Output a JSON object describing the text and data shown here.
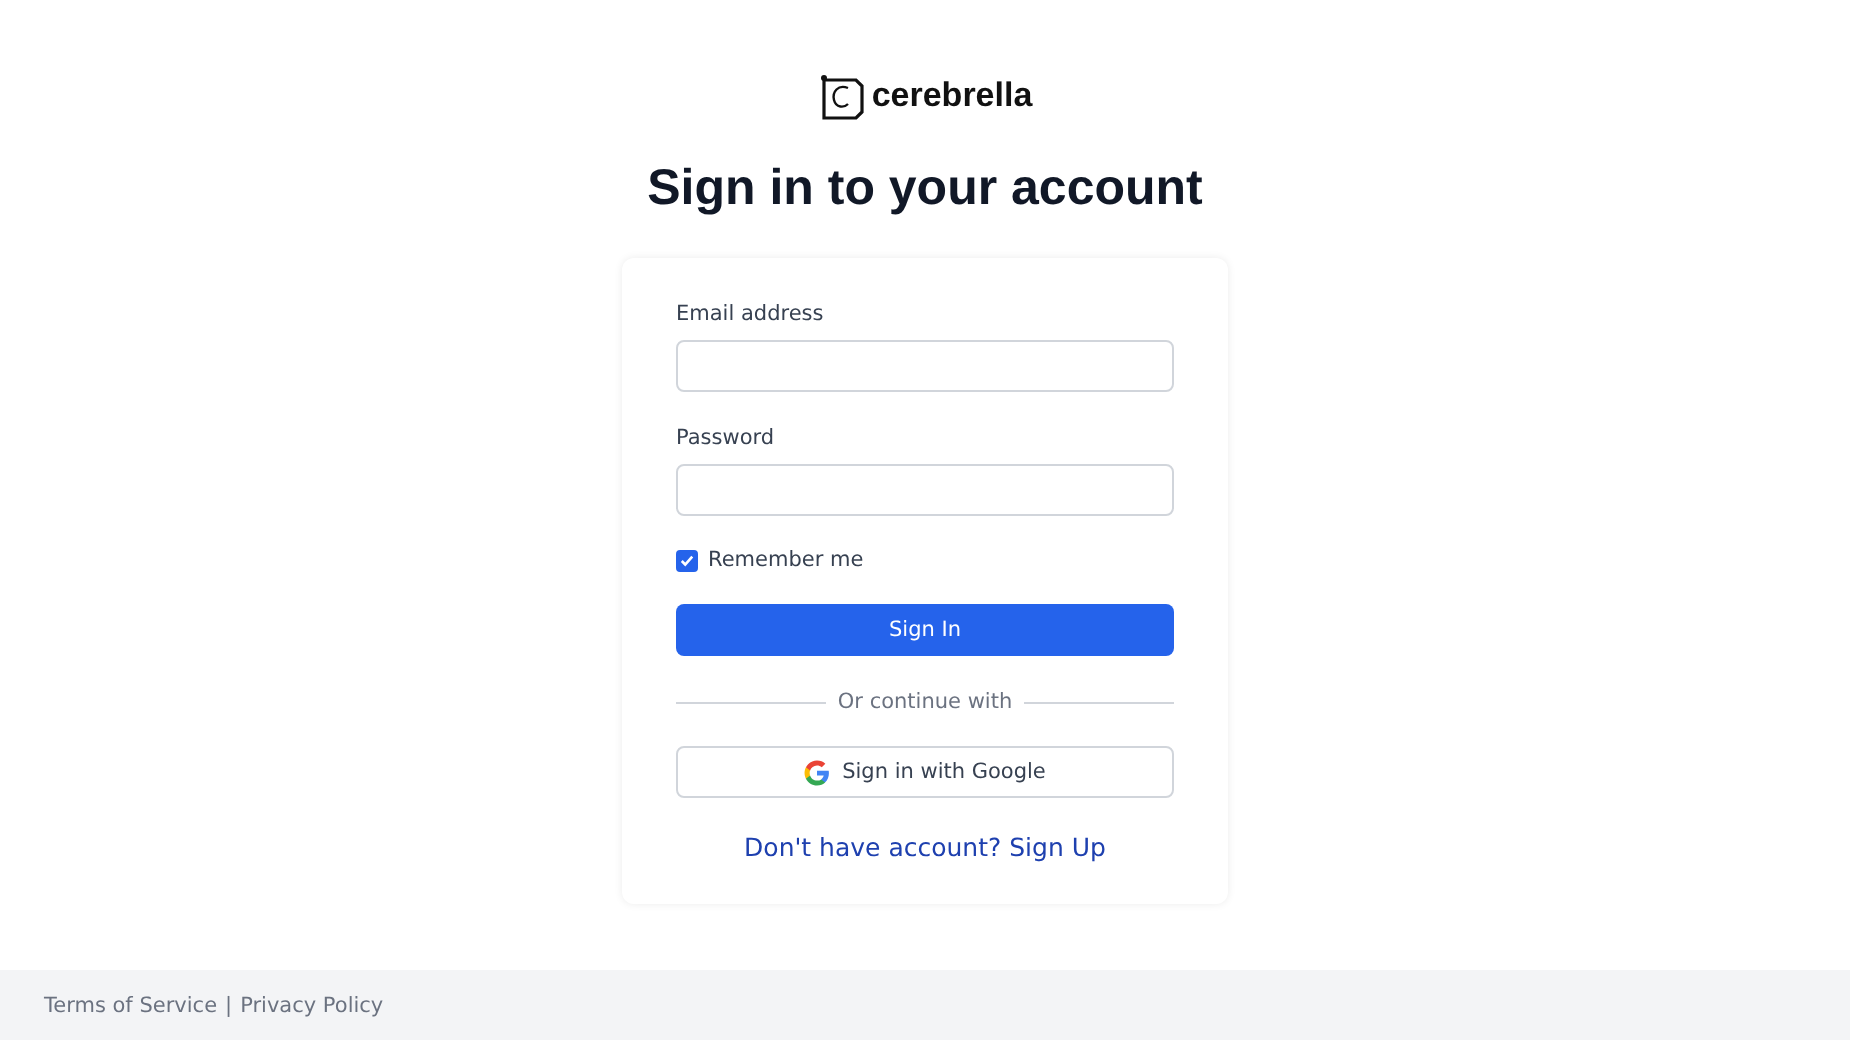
{
  "logo": {
    "text": "cerebrella"
  },
  "title": "Sign in to your account",
  "form": {
    "email": {
      "label": "Email address"
    },
    "password": {
      "label": "Password"
    },
    "remember": {
      "label": "Remember me",
      "checked": true
    },
    "submit": "Sign In",
    "divider": "Or continue with",
    "google": "Sign in with Google",
    "signup": "Don't have account? Sign Up"
  },
  "footer": {
    "links": [
      "Terms of Service",
      "Privacy Policy"
    ],
    "separator": "|"
  }
}
